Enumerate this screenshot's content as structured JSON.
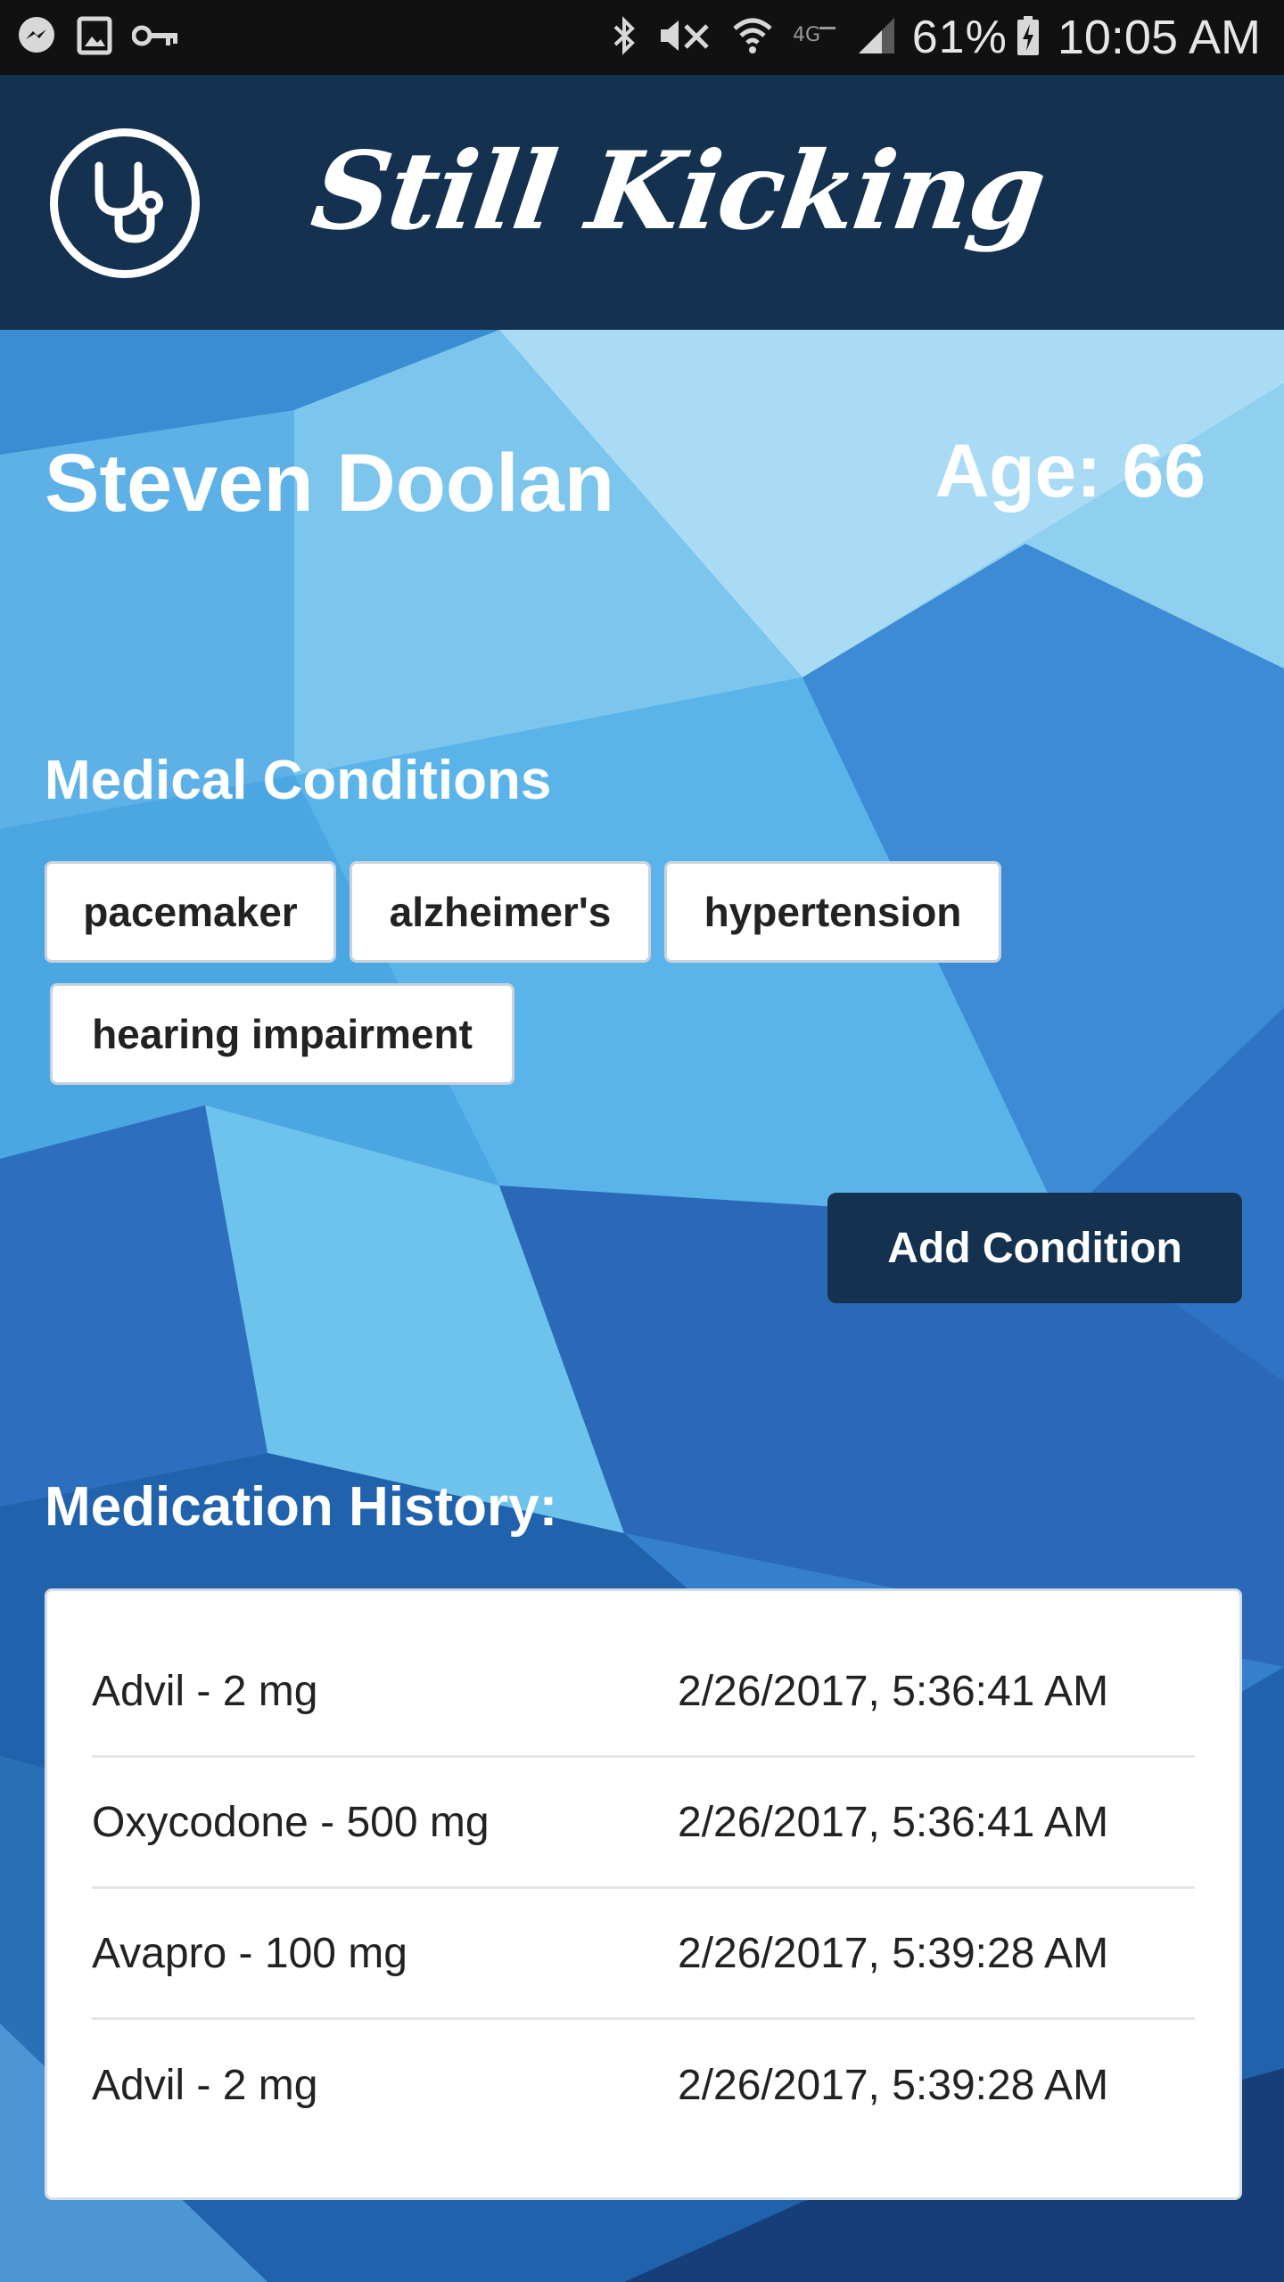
{
  "status_bar": {
    "icons_left": [
      "messenger-icon",
      "image-icon",
      "key-icon"
    ],
    "icons_right": [
      "bluetooth-icon",
      "mute-vibrate-icon",
      "wifi-icon",
      "lte-icon",
      "signal-icon"
    ],
    "battery_percent": "61%",
    "battery_icon": "battery-charging-icon",
    "time": "10:05 AM"
  },
  "app_bar": {
    "logo_icon": "stethoscope-icon",
    "title": "Still Kicking"
  },
  "patient": {
    "name": "Steven Doolan",
    "age_label": "Age: 66"
  },
  "conditions": {
    "heading": "Medical Conditions",
    "items": [
      "pacemaker",
      "alzheimer's",
      "hypertension",
      "hearing impairment"
    ],
    "add_button_label": "Add Condition"
  },
  "medications": {
    "heading": "Medication History:",
    "rows": [
      {
        "name": "Advil - 2 mg",
        "time": "2/26/2017, 5:36:41 AM"
      },
      {
        "name": "Oxycodone - 500 mg",
        "time": "2/26/2017, 5:36:41 AM"
      },
      {
        "name": "Avapro - 100 mg",
        "time": "2/26/2017, 5:39:28 AM"
      },
      {
        "name": "Advil - 2 mg",
        "time": "2/26/2017, 5:39:28 AM"
      }
    ]
  },
  "colors": {
    "app_bar": "#14324f",
    "status_bar": "#111111",
    "background_light": "#8fd0f0",
    "background_dark": "#1b4f98"
  }
}
